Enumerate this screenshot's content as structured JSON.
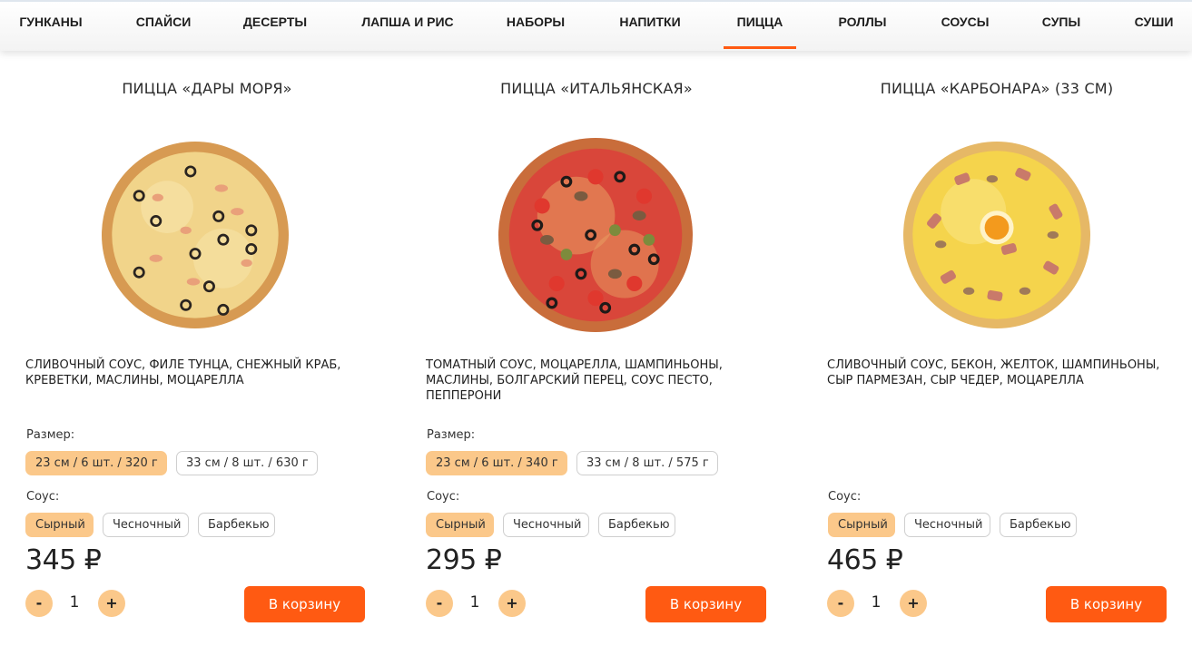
{
  "nav": {
    "items": [
      {
        "label": "ГУНКАНЫ"
      },
      {
        "label": "СПАЙСИ"
      },
      {
        "label": "ДЕСЕРТЫ"
      },
      {
        "label": "ЛАПША И РИС"
      },
      {
        "label": "НАБОРЫ"
      },
      {
        "label": "НАПИТКИ"
      },
      {
        "label": "ПИЦЦА",
        "active": true
      },
      {
        "label": "РОЛЛЫ"
      },
      {
        "label": "СОУСЫ"
      },
      {
        "label": "СУПЫ"
      },
      {
        "label": "СУШИ"
      }
    ]
  },
  "colors": {
    "accent": "#ff5a12",
    "chip_selected": "#fbc88a"
  },
  "products": [
    {
      "title": "ПИЦЦА «ДАРЫ МОРЯ»",
      "description": "СЛИВОЧНЫЙ СОУС, ФИЛЕ ТУНЦА, СНЕЖНЫЙ КРАБ, КРЕВЕТКИ, МАСЛИНЫ, МОЦАРЕЛЛА",
      "size_label": "Размер:",
      "sizes": [
        "23 см / 6 шт. / 320 г",
        "33 см / 8 шт. / 630 г"
      ],
      "selected_size": 0,
      "sauce_label": "Соус:",
      "sauces": [
        "Сырный",
        "Чесночный",
        "Барбекью"
      ],
      "selected_sauce": 0,
      "price": "345 ₽",
      "quantity": "1",
      "minus": "-",
      "plus": "+",
      "cart_label": "В корзину"
    },
    {
      "title": "ПИЦЦА «ИТАЛЬЯНСКАЯ»",
      "description": "ТОМАТНЫЙ СОУС, МОЦАРЕЛЛА, ШАМПИНЬОНЫ, МАСЛИНЫ, БОЛГАРСКИЙ ПЕРЕЦ, СОУС ПЕСТО, ПЕППЕРОНИ",
      "size_label": "Размер:",
      "sizes": [
        "23 см / 6 шт. / 340 г",
        "33 см / 8 шт. / 575 г"
      ],
      "selected_size": 0,
      "sauce_label": "Соус:",
      "sauces": [
        "Сырный",
        "Чесночный",
        "Барбекью"
      ],
      "selected_sauce": 0,
      "price": "295 ₽",
      "quantity": "1",
      "minus": "-",
      "plus": "+",
      "cart_label": "В корзину"
    },
    {
      "title": "ПИЦЦА «КАРБОНАРА» (33 СМ)",
      "description": "СЛИВОЧНЫЙ СОУС, БЕКОН, ЖЕЛТОК, ШАМПИНЬОНЫ, СЫР ПАРМЕЗАН, СЫР ЧЕДЕР, МОЦАРЕЛЛА",
      "sauce_label": "Соус:",
      "sauces": [
        "Сырный",
        "Чесночный",
        "Барбекью"
      ],
      "selected_sauce": 0,
      "price": "465 ₽",
      "quantity": "1",
      "minus": "-",
      "plus": "+",
      "cart_label": "В корзину"
    }
  ]
}
